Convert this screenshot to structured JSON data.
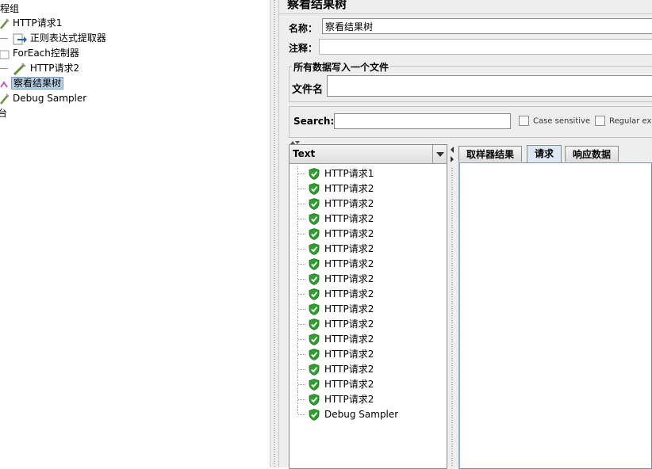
{
  "tree": {
    "items": [
      {
        "label": "线程组"
      },
      {
        "label": "HTTP请求1"
      },
      {
        "label": "正则表达式提取器"
      },
      {
        "label": "ForEach控制器"
      },
      {
        "label": "HTTP请求2"
      },
      {
        "label": "察看结果树"
      },
      {
        "label": "Debug Sampler"
      },
      {
        "label": "台"
      }
    ]
  },
  "panel": {
    "title": "察看结果树",
    "name_label": "名称：",
    "name_value": "察看结果树",
    "comment_label": "注释：",
    "comment_value": "",
    "file_group_label": "所有数据写入一个文件",
    "filename_label": "文件名",
    "filename_value": "",
    "search_label": "Search:",
    "search_value": "",
    "case_sensitive_label": "Case sensitive",
    "regex_label": "Regular exp"
  },
  "results": {
    "renderer": "Text",
    "rows": [
      {
        "label": "HTTP请求1"
      },
      {
        "label": "HTTP请求2"
      },
      {
        "label": "HTTP请求2"
      },
      {
        "label": "HTTP请求2"
      },
      {
        "label": "HTTP请求2"
      },
      {
        "label": "HTTP请求2"
      },
      {
        "label": "HTTP请求2"
      },
      {
        "label": "HTTP请求2"
      },
      {
        "label": "HTTP请求2"
      },
      {
        "label": "HTTP请求2"
      },
      {
        "label": "HTTP请求2"
      },
      {
        "label": "HTTP请求2"
      },
      {
        "label": "HTTP请求2"
      },
      {
        "label": "HTTP请求2"
      },
      {
        "label": "HTTP请求2"
      },
      {
        "label": "HTTP请求2"
      },
      {
        "label": "Debug Sampler"
      }
    ]
  },
  "tabs": [
    {
      "label": "取样器结果"
    },
    {
      "label": "请求"
    },
    {
      "label": "响应数据"
    }
  ],
  "colors": {
    "success": "#2e9e2e",
    "selection": "#b8cfe5",
    "panel_bg": "#eeeeee"
  }
}
